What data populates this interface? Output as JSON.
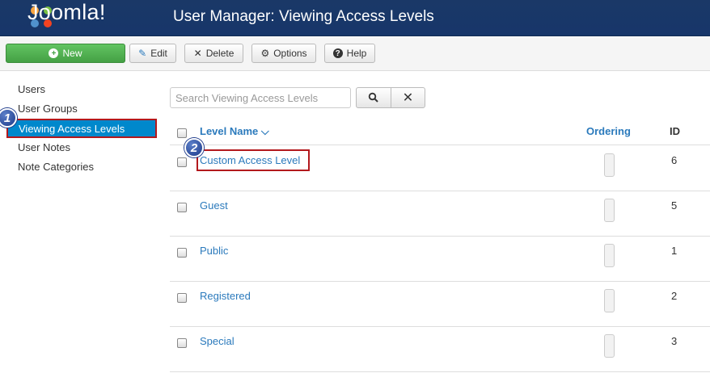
{
  "header": {
    "logo_text": "Joomla!",
    "title": "User Manager: Viewing Access Levels"
  },
  "toolbar": {
    "new_label": "New",
    "edit_label": "Edit",
    "delete_label": "Delete",
    "options_label": "Options",
    "help_label": "Help"
  },
  "sidebar": {
    "items": [
      {
        "label": "Users"
      },
      {
        "label": "User Groups"
      },
      {
        "label": "Viewing Access Levels",
        "active": true
      },
      {
        "label": "User Notes"
      },
      {
        "label": "Note Categories"
      }
    ]
  },
  "search": {
    "placeholder": "Search Viewing Access Levels"
  },
  "table": {
    "headers": {
      "level_name": "Level Name",
      "ordering": "Ordering",
      "id": "ID"
    },
    "rows": [
      {
        "name": "Custom Access Level",
        "id": "6"
      },
      {
        "name": "Guest",
        "id": "5"
      },
      {
        "name": "Public",
        "id": "1"
      },
      {
        "name": "Registered",
        "id": "2"
      },
      {
        "name": "Special",
        "id": "3"
      }
    ]
  },
  "annotations": {
    "step1": "1",
    "step2": "2"
  },
  "colors": {
    "header_bg": "#1a3867",
    "accent": "#0088cc",
    "link": "#2b7abc",
    "highlight_border": "#b3191d",
    "new_button": "#51a351"
  }
}
